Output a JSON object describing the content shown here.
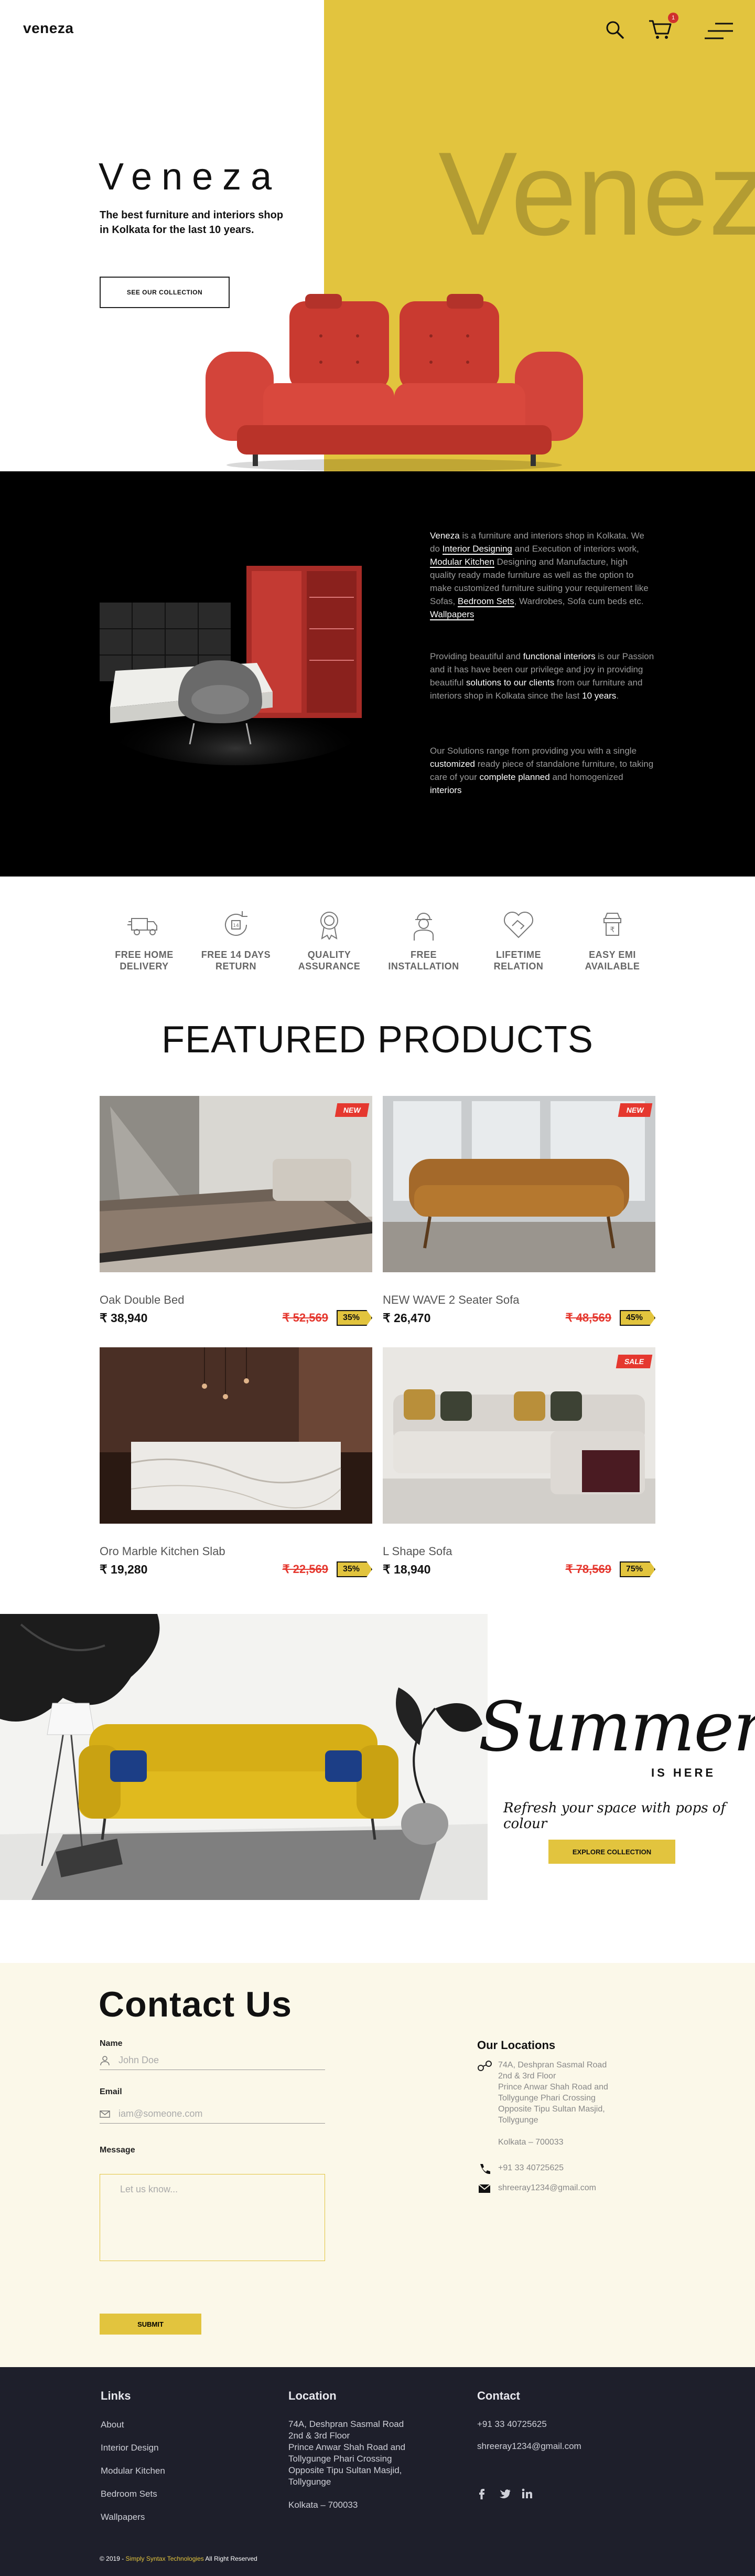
{
  "header": {
    "logo": "veneza",
    "cart_count": "1"
  },
  "hero": {
    "title": "Veneza",
    "subtitle": "The best furniture and interiors shop in Kolkata for the last 10 years.",
    "button": "SEE OUR COLLECTION",
    "watermark": "Veneza"
  },
  "about": {
    "p1": [
      {
        "t": "Veneza",
        "s": "b"
      },
      {
        "t": " is a furniture and interiors shop in Kolkata. We do ",
        "s": ""
      },
      {
        "t": "Interior Designing",
        "s": "u"
      },
      {
        "t": " and Execution of interiors work, ",
        "s": ""
      },
      {
        "t": "Modular Kitchen",
        "s": "u"
      },
      {
        "t": " Designing and Manufacture, high quality ready made furniture as well as the option to make customized furniture suiting your requirement like Sofas, ",
        "s": ""
      },
      {
        "t": "Bedroom Sets",
        "s": "u"
      },
      {
        "t": ", Wardrobes, Sofa cum beds etc. ",
        "s": ""
      },
      {
        "t": "Wallpapers",
        "s": "u"
      }
    ],
    "p2": [
      {
        "t": "Providing beautiful and ",
        "s": ""
      },
      {
        "t": "functional interiors",
        "s": "b"
      },
      {
        "t": " is our Passion and it has  have been our privilege and joy in providing beautiful ",
        "s": ""
      },
      {
        "t": "solutions to our clients",
        "s": "b"
      },
      {
        "t": " from our furniture and interiors shop in Kolkata since the last ",
        "s": ""
      },
      {
        "t": "10 years",
        "s": "b"
      },
      {
        "t": ".",
        "s": ""
      }
    ],
    "p3": [
      {
        "t": "Our Solutions range from providing you with a single ",
        "s": ""
      },
      {
        "t": "customized",
        "s": "b"
      },
      {
        "t": " ready piece of standalone furniture, to taking care of your ",
        "s": ""
      },
      {
        "t": "complete planned",
        "s": "b"
      },
      {
        "t": " and homogenized ",
        "s": ""
      },
      {
        "t": "interiors",
        "s": "b"
      }
    ]
  },
  "features": [
    {
      "l1": "FREE HOME",
      "l2": "DELIVERY",
      "icon": "truck-icon"
    },
    {
      "l1": "FREE 14 DAYS",
      "l2": "RETURN",
      "icon": "return-icon"
    },
    {
      "l1": "QUALITY",
      "l2": "ASSURANCE",
      "icon": "award-icon"
    },
    {
      "l1": "FREE",
      "l2": "INSTALLATION",
      "icon": "worker-icon"
    },
    {
      "l1": "LIFETIME",
      "l2": "RELATION",
      "icon": "handshake-icon"
    },
    {
      "l1": "EASY EMI",
      "l2": "AVAILABLE",
      "icon": "emi-icon"
    }
  ],
  "featured": {
    "title": "FEATURED PRODUCTS",
    "products": [
      {
        "name": "Oak Double Bed",
        "price": "₹ 38,940",
        "old": "₹ 52,569",
        "off": "35%",
        "badge": "NEW"
      },
      {
        "name": "NEW WAVE 2 Seater Sofa",
        "price": "₹ 26,470",
        "old": "₹ 48,569",
        "off": "45%",
        "badge": "NEW"
      },
      {
        "name": "Oro Marble Kitchen Slab",
        "price": "₹ 19,280",
        "old": "₹ 22,569",
        "off": "35%",
        "badge": ""
      },
      {
        "name": "L Shape Sofa",
        "price": "₹ 18,940",
        "old": "₹ 78,569",
        "off": "75%",
        "badge": "SALE"
      }
    ]
  },
  "summer": {
    "script": "Summer",
    "is_here": "IS HERE",
    "tagline": "Refresh your space with pops of colour",
    "button": "EXPLORE COLLECTION"
  },
  "contact": {
    "title": "Contact Us",
    "name_label": "Name",
    "name_placeholder": "John Doe",
    "email_label": "Email",
    "email_placeholder": "iam@someone.com",
    "message_label": "Message",
    "message_placeholder": "Let us know...",
    "submit": "SUBMIT",
    "locations_title": "Our Locations",
    "address": "74A, Deshpran Sasmal Road\n2nd & 3rd Floor\nPrince Anwar Shah Road and Tollygunge Phari Crossing\nOpposite Tipu Sultan Masjid, Tollygunge\n\nKolkata – 700033",
    "phone": "+91 33 40725625",
    "email": "shreeray1234@gmail.com"
  },
  "footer": {
    "links_title": "Links",
    "links": [
      "About",
      "Interior Design",
      "Modular Kitchen",
      "Bedroom Sets",
      "Wallpapers"
    ],
    "location_title": "Location",
    "location_text": "74A, Deshpran Sasmal Road\n2nd & 3rd Floor\nPrince Anwar Shah Road and Tollygunge Phari Crossing\nOpposite Tipu Sultan Masjid,\nTollygunge\n\nKolkata – 700033",
    "contact_title": "Contact",
    "phone": "+91 33 40725625",
    "email": "shreeray1234@gmail.com",
    "copy_prefix": "© 2019 - ",
    "copy_company": "Simply Syntax Technologies",
    "copy_suffix": " All Right Reserved"
  },
  "colors": {
    "accent_yellow": "#e2c43e",
    "sale_red": "#e5382f",
    "footer_bg": "#1e1f2b",
    "contact_bg": "#fbf8e9"
  }
}
